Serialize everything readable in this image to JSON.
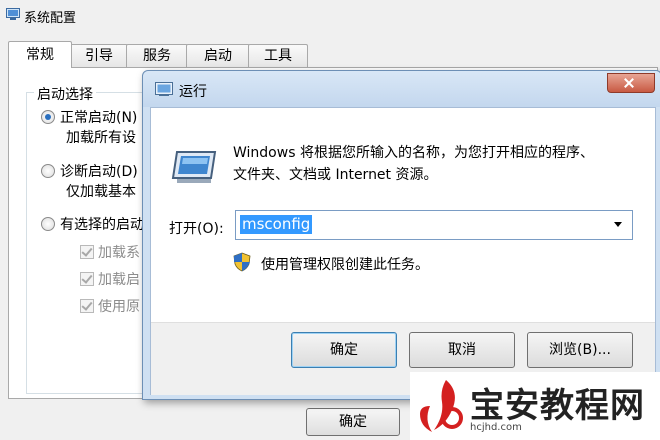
{
  "msconfig": {
    "title": "系统配置",
    "tabs": [
      "常规",
      "引导",
      "服务",
      "启动",
      "工具"
    ],
    "startup_group_label": "启动选择",
    "options": [
      {
        "label": "正常启动(N)",
        "sub": "加载所有设",
        "checked": true
      },
      {
        "label": "诊断启动(D)",
        "sub": "仅加载基本",
        "checked": false
      },
      {
        "label": "有选择的启动",
        "sub": "",
        "checked": false
      }
    ],
    "checkboxes": [
      "加载系",
      "加载启",
      "使用原"
    ],
    "ok_label": "确定"
  },
  "run_dialog": {
    "title": "运行",
    "description_line1": "Windows 将根据您所输入的名称，为您打开相应的程序、",
    "description_line2": "文件夹、文档或 Internet 资源。",
    "open_label": "打开(O):",
    "open_value": "msconfig",
    "admin_note": "使用管理权限创建此任务。",
    "buttons": {
      "ok": "确定",
      "cancel": "取消",
      "browse": "浏览(B)..."
    }
  },
  "watermark": {
    "title": "宝安教程网",
    "url": "hcjhd.com"
  },
  "colors": {
    "selection": "#3399ff",
    "dialog_frame": "#cfe0f2",
    "watermark_red": "#d42020"
  }
}
